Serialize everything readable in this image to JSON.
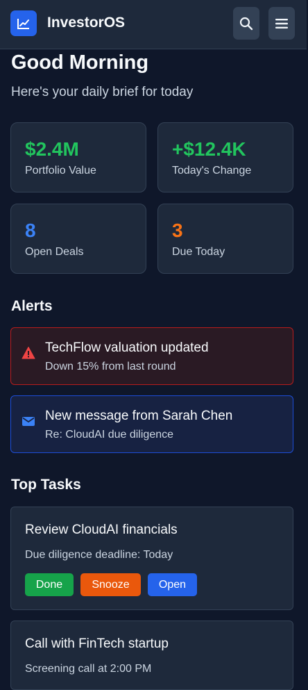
{
  "app": {
    "title": "InvestorOS",
    "logo_icon": "chart-line-icon",
    "search_icon": "search-icon",
    "menu_icon": "hamburger-menu-icon"
  },
  "header": {
    "greeting": "Good Morning",
    "subtitle": "Here's your daily brief for today"
  },
  "stats": [
    {
      "value": "$2.4M",
      "label": "Portfolio Value",
      "color": "#22c55e"
    },
    {
      "value": "+$12.4K",
      "label": "Today's Change",
      "color": "#22c55e"
    },
    {
      "value": "8",
      "label": "Open Deals",
      "color": "#3b82f6"
    },
    {
      "value": "3",
      "label": "Due Today",
      "color": "#f97316"
    }
  ],
  "alerts": {
    "title": "Alerts",
    "items": [
      {
        "icon": "warning-triangle-icon",
        "title": "TechFlow valuation updated",
        "subtitle": "Down 15% from last round",
        "accent": "#dc2626"
      },
      {
        "icon": "envelope-icon",
        "title": "New message from Sarah Chen",
        "subtitle": "Re: CloudAI due diligence",
        "accent": "#2563eb"
      }
    ]
  },
  "tasks": {
    "title": "Top Tasks",
    "items": [
      {
        "title": "Review CloudAI financials",
        "subtitle": "Due diligence deadline: Today",
        "buttons": [
          {
            "label": "Done",
            "color": "#16a34a"
          },
          {
            "label": "Snooze",
            "color": "#ea580c"
          },
          {
            "label": "Open",
            "color": "#2563eb"
          }
        ]
      },
      {
        "title": "Call with FinTech startup",
        "subtitle": "Screening call at 2:00 PM"
      }
    ]
  }
}
